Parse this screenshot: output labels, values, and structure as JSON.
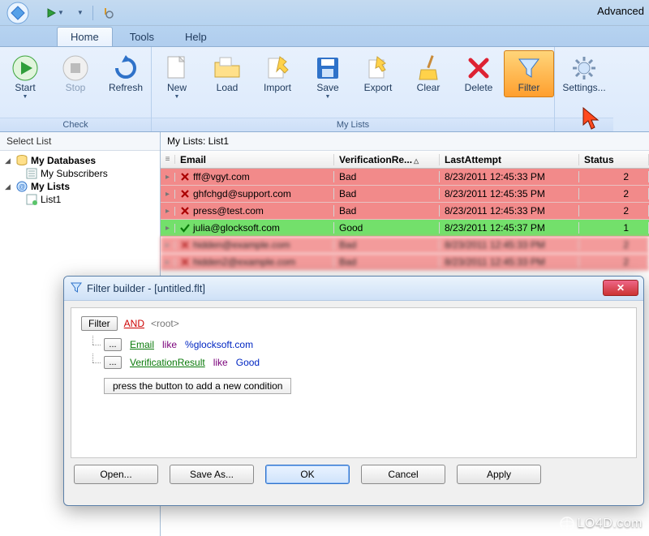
{
  "app": {
    "title_right": "Advanced"
  },
  "menu": {
    "tabs": [
      "Home",
      "Tools",
      "Help"
    ],
    "active": 0
  },
  "ribbon": {
    "groups": [
      {
        "label": "Check",
        "items": [
          {
            "name": "start",
            "label": "Start",
            "dd": true
          },
          {
            "name": "stop",
            "label": "Stop",
            "disabled": true
          },
          {
            "name": "refresh",
            "label": "Refresh"
          }
        ]
      },
      {
        "label": "My Lists",
        "items": [
          {
            "name": "new",
            "label": "New",
            "dd": true
          },
          {
            "name": "load",
            "label": "Load"
          },
          {
            "name": "import",
            "label": "Import"
          },
          {
            "name": "save",
            "label": "Save",
            "dd": true
          },
          {
            "name": "export",
            "label": "Export"
          },
          {
            "name": "clear",
            "label": "Clear"
          },
          {
            "name": "delete",
            "label": "Delete"
          },
          {
            "name": "filter",
            "label": "Filter",
            "active": true
          }
        ]
      },
      {
        "label": "",
        "items": [
          {
            "name": "settings",
            "label": "Settings..."
          }
        ]
      }
    ]
  },
  "leftpane": {
    "header": "Select List",
    "tree": {
      "db": "My Databases",
      "db_sub": "My Subscribers",
      "lists": "My Lists",
      "list1": "List1"
    }
  },
  "main": {
    "title": "My Lists: List1",
    "columns": {
      "email": "Email",
      "ver": "VerificationRe...",
      "last": "LastAttempt",
      "status": "Status"
    },
    "rows": [
      {
        "email": "fff@vgyt.com",
        "ver": "Bad",
        "last": "8/23/2011 12:45:33 PM",
        "status": "2",
        "kind": "bad"
      },
      {
        "email": "ghfchgd@support.com",
        "ver": "Bad",
        "last": "8/23/2011 12:45:35 PM",
        "status": "2",
        "kind": "bad"
      },
      {
        "email": "press@test.com",
        "ver": "Bad",
        "last": "8/23/2011 12:45:33 PM",
        "status": "2",
        "kind": "bad"
      },
      {
        "email": "julia@glocksoft.com",
        "ver": "Good",
        "last": "8/23/2011 12:45:37 PM",
        "status": "1",
        "kind": "good"
      },
      {
        "email": "hidden@example.com",
        "ver": "Bad",
        "last": "8/23/2011 12:45:33 PM",
        "status": "2",
        "kind": "bad",
        "blur": true
      },
      {
        "email": "hidden2@example.com",
        "ver": "Bad",
        "last": "8/23/2011 12:45:33 PM",
        "status": "2",
        "kind": "bad",
        "blur": true
      }
    ]
  },
  "dialog": {
    "title": "Filter builder - [untitled.flt]",
    "root_btn": "Filter",
    "root_op": "AND",
    "root_lbl": "<root>",
    "rules": [
      {
        "field": "Email",
        "op": "like",
        "value": "%glocksoft.com"
      },
      {
        "field": "VerificationResult",
        "op": "like",
        "value": "Good"
      }
    ],
    "add": "press the button to add a new condition",
    "buttons": {
      "open": "Open...",
      "save": "Save As...",
      "ok": "OK",
      "cancel": "Cancel",
      "apply": "Apply"
    }
  },
  "watermark": "LO4D.com"
}
